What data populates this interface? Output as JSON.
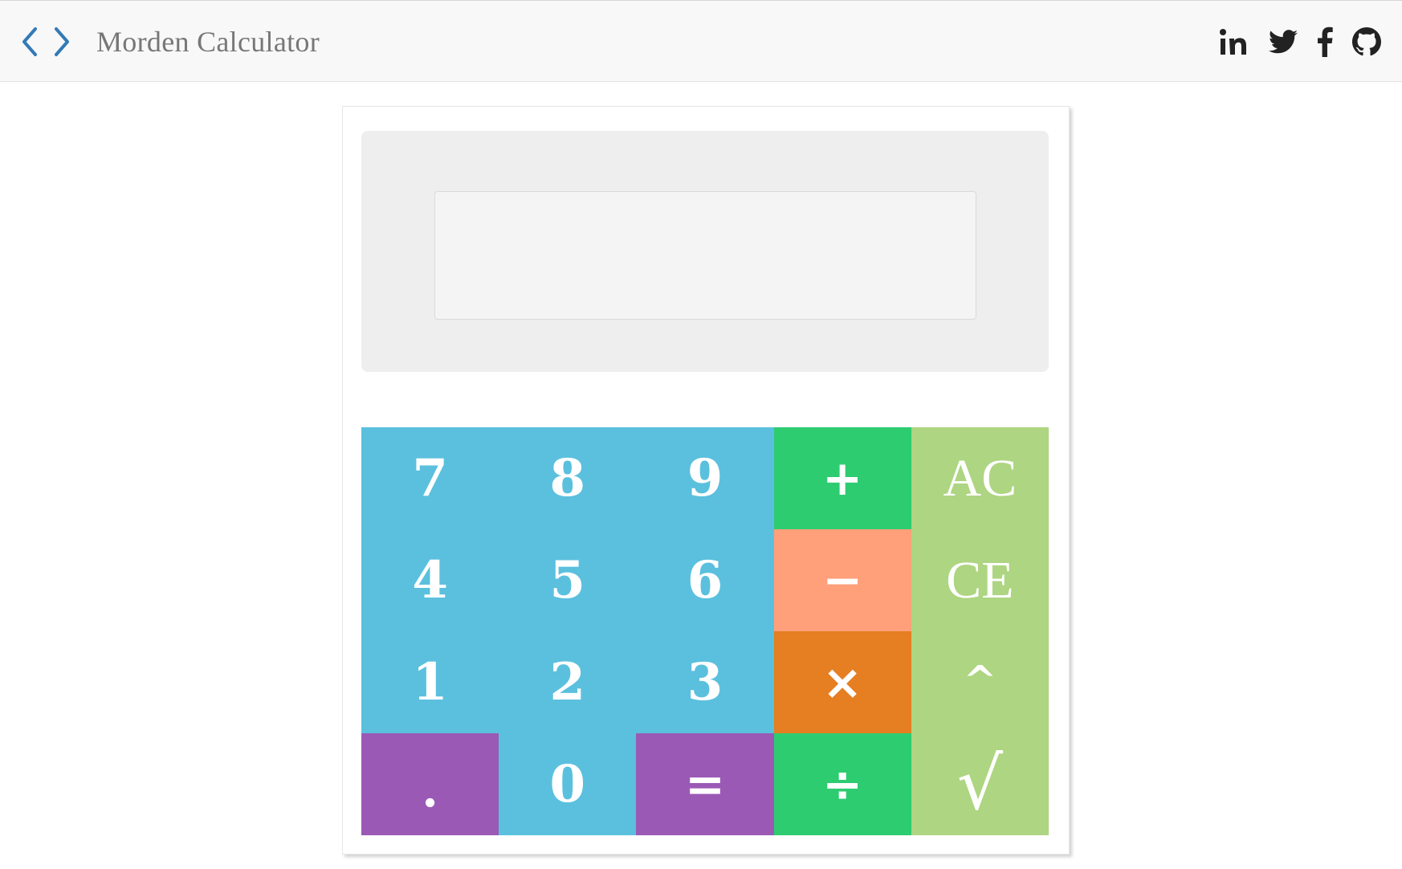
{
  "app": {
    "title": "Morden Calculator",
    "brand_icon": "code-brackets-icon",
    "accent_color": "#337ab7"
  },
  "social_links": [
    {
      "name": "linkedin",
      "icon": "linkedin-icon",
      "label": "in"
    },
    {
      "name": "twitter",
      "icon": "twitter-icon"
    },
    {
      "name": "facebook",
      "icon": "facebook-icon"
    },
    {
      "name": "github",
      "icon": "github-icon"
    }
  ],
  "display": {
    "value": "",
    "placeholder": ""
  },
  "keys": [
    {
      "id": "seven",
      "label": "7",
      "color": "#5bc0de"
    },
    {
      "id": "eight",
      "label": "8",
      "color": "#5bc0de"
    },
    {
      "id": "nine",
      "label": "9",
      "color": "#5bc0de"
    },
    {
      "id": "add",
      "label": "+",
      "color": "#2ecc71"
    },
    {
      "id": "all-clear",
      "label": "AC",
      "color": "#aed581"
    },
    {
      "id": "four",
      "label": "4",
      "color": "#5bc0de"
    },
    {
      "id": "five",
      "label": "5",
      "color": "#5bc0de"
    },
    {
      "id": "six",
      "label": "6",
      "color": "#5bc0de"
    },
    {
      "id": "subtract",
      "label": "−",
      "color": "#ffa07a"
    },
    {
      "id": "clear-entry",
      "label": "CE",
      "color": "#aed581"
    },
    {
      "id": "one",
      "label": "1",
      "color": "#5bc0de"
    },
    {
      "id": "two",
      "label": "2",
      "color": "#5bc0de"
    },
    {
      "id": "three",
      "label": "3",
      "color": "#5bc0de"
    },
    {
      "id": "multiply",
      "label": "×",
      "color": "#e67e22"
    },
    {
      "id": "power",
      "label": "^",
      "color": "#aed581"
    },
    {
      "id": "decimal",
      "label": ".",
      "color": "#9b59b6"
    },
    {
      "id": "zero",
      "label": "0",
      "color": "#5bc0de"
    },
    {
      "id": "equals",
      "label": "=",
      "color": "#9b59b6"
    },
    {
      "id": "divide",
      "label": "÷",
      "color": "#2ecc71"
    },
    {
      "id": "sqrt",
      "label": "√",
      "color": "#aed581"
    }
  ]
}
